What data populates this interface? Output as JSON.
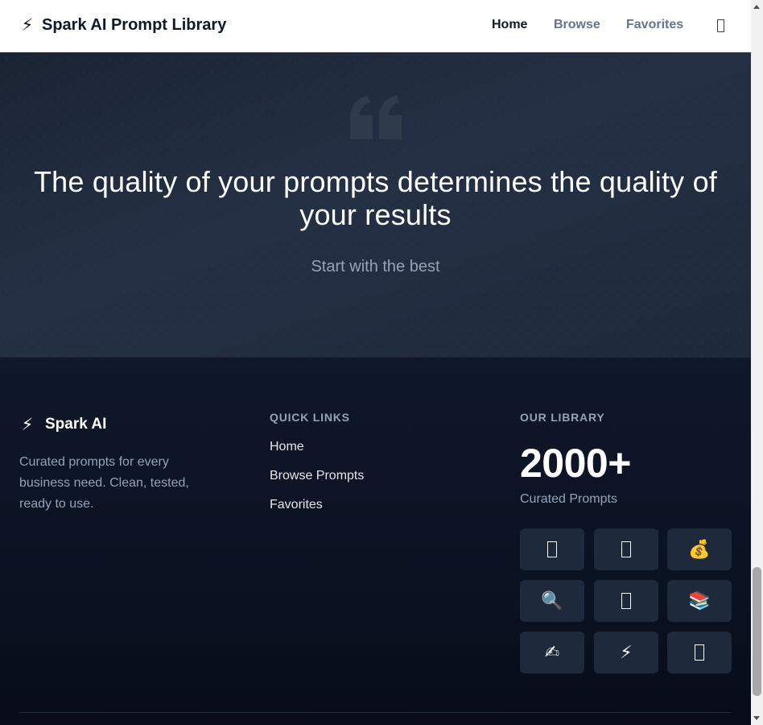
{
  "navbar": {
    "brand_icon": "⚡",
    "brand_name": "Spark AI Prompt Library",
    "links": [
      {
        "label": "Home",
        "active": true
      },
      {
        "label": "Browse",
        "active": false
      },
      {
        "label": "Favorites",
        "active": false
      }
    ],
    "theme_icon": "missing-glyph-icon"
  },
  "hero": {
    "quote_icon": "quote-icon",
    "title": "The quality of your prompts determines the quality of your results",
    "subtitle": "Start with the best"
  },
  "footer": {
    "brand_icon": "⚡",
    "brand_name": "Spark AI",
    "description": "Curated prompts for every business need. Clean, tested, ready to use.",
    "quick_links_heading": "QUICK LINKS",
    "quick_links": [
      "Home",
      "Browse Prompts",
      "Favorites"
    ],
    "library_heading": "OUR LIBRARY",
    "library_count": "2000+",
    "library_count_label": "Curated Prompts",
    "category_tiles": [
      {
        "icon": "missing-glyph-icon",
        "glyph": ""
      },
      {
        "icon": "missing-glyph-icon",
        "glyph": ""
      },
      {
        "icon": "money-bag-icon",
        "glyph": "💰"
      },
      {
        "icon": "magnifier-icon",
        "glyph": "🔍"
      },
      {
        "icon": "missing-glyph-icon",
        "glyph": ""
      },
      {
        "icon": "books-icon",
        "glyph": "📚"
      },
      {
        "icon": "writing-hand-icon",
        "glyph": "✍"
      },
      {
        "icon": "lightning-icon",
        "glyph": "⚡"
      },
      {
        "icon": "missing-glyph-icon",
        "glyph": ""
      }
    ]
  },
  "colors": {
    "nav_bg": "#ffffff",
    "hero_bg": "#1e293b",
    "footer_bg": "#0f172a",
    "tile_bg": "#1e293b",
    "muted_text": "#94a3b8"
  }
}
